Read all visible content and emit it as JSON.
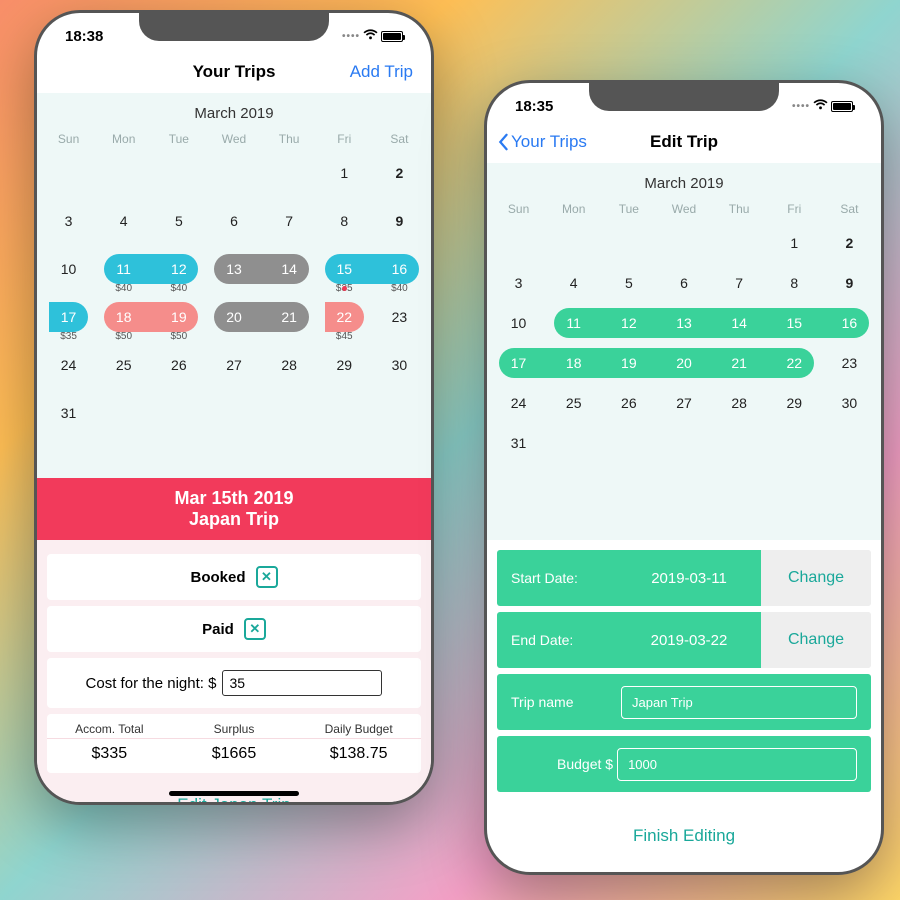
{
  "left": {
    "time": "18:38",
    "title": "Your Trips",
    "addTrip": "Add Trip",
    "month": "March 2019",
    "dow": [
      "Sun",
      "Mon",
      "Tue",
      "Wed",
      "Thu",
      "Fri",
      "Sat"
    ],
    "prices": {
      "11": "$40",
      "12": "$40",
      "15": "$35",
      "16": "$40",
      "17": "$35",
      "18": "$50",
      "19": "$50",
      "22": "$45"
    },
    "selected": {
      "dateLine": "Mar 15th 2019",
      "tripLine": "Japan Trip"
    },
    "booked": "Booked",
    "paid": "Paid",
    "costLabel": "Cost for the night: $",
    "costValue": "35",
    "totals": {
      "h1": "Accom. Total",
      "h2": "Surplus",
      "h3": "Daily Budget",
      "v1": "$335",
      "v2": "$1665",
      "v3": "$138.75"
    },
    "editBtn": "Edit Japan Trip"
  },
  "right": {
    "time": "18:35",
    "back": "Your Trips",
    "title": "Edit Trip",
    "month": "March 2019",
    "dow": [
      "Sun",
      "Mon",
      "Tue",
      "Wed",
      "Thu",
      "Fri",
      "Sat"
    ],
    "start": {
      "label": "Start Date:",
      "value": "2019-03-11",
      "change": "Change"
    },
    "end": {
      "label": "End Date:",
      "value": "2019-03-22",
      "change": "Change"
    },
    "name": {
      "label": "Trip name",
      "value": "Japan Trip"
    },
    "budget": {
      "label": "Budget $",
      "value": "1000"
    },
    "finish": "Finish Editing"
  }
}
